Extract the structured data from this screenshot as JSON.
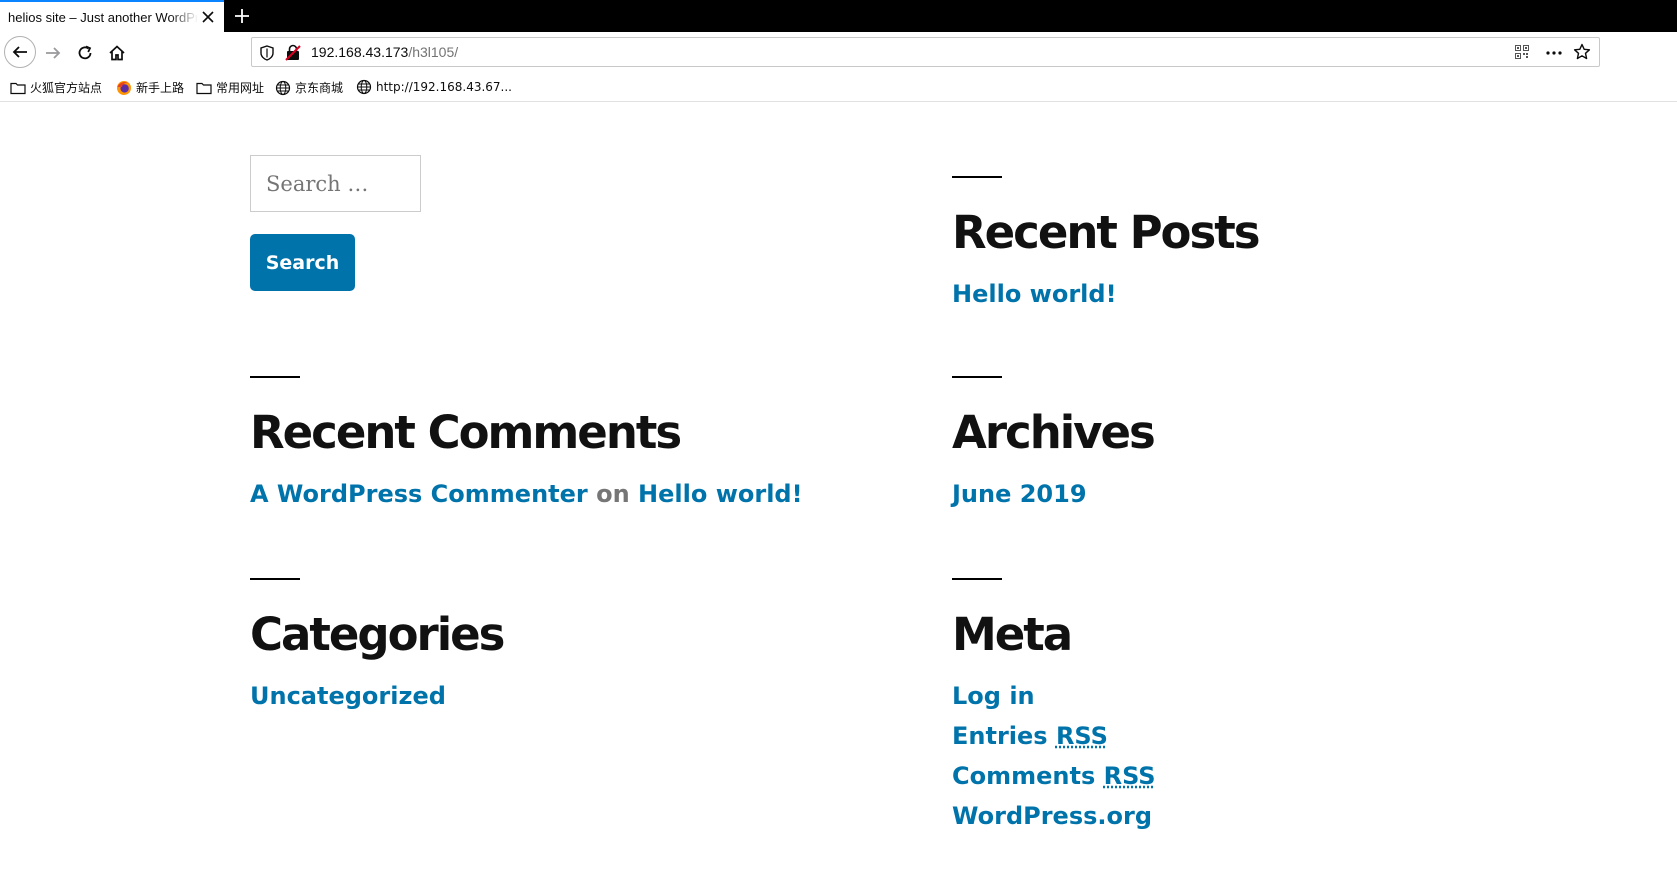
{
  "browser": {
    "tab_title": "helios site – Just another WordPress site",
    "url_host": "192.168.43.173",
    "url_path": "/h3l105/",
    "bookmarks": [
      {
        "label": "火狐官方站点",
        "icon": "folder-icon"
      },
      {
        "label": "新手上路",
        "icon": "firefox-icon"
      },
      {
        "label": "常用网址",
        "icon": "folder-icon"
      },
      {
        "label": "京东商城",
        "icon": "globe-icon"
      },
      {
        "label": "http://192.168.43.67...",
        "icon": "globe-icon"
      }
    ]
  },
  "search": {
    "placeholder": "Search …",
    "button_label": "Search"
  },
  "widgets": {
    "recent_posts": {
      "title": "Recent Posts",
      "items": [
        "Hello world!"
      ]
    },
    "recent_comments": {
      "title": "Recent Comments",
      "author": "A WordPress Commenter",
      "connector": "on",
      "post": "Hello world!"
    },
    "archives": {
      "title": "Archives",
      "items": [
        "June 2019"
      ]
    },
    "categories": {
      "title": "Categories",
      "items": [
        "Uncategorized"
      ]
    },
    "meta": {
      "title": "Meta",
      "log_in": "Log in",
      "entries_prefix": "Entries",
      "entries_rss": "RSS",
      "comments_prefix": "Comments",
      "comments_rss": "RSS",
      "wordpress_org": "WordPress.org"
    }
  },
  "colors": {
    "link": "#0073aa",
    "heading": "#111111",
    "button_bg": "#0073aa"
  }
}
